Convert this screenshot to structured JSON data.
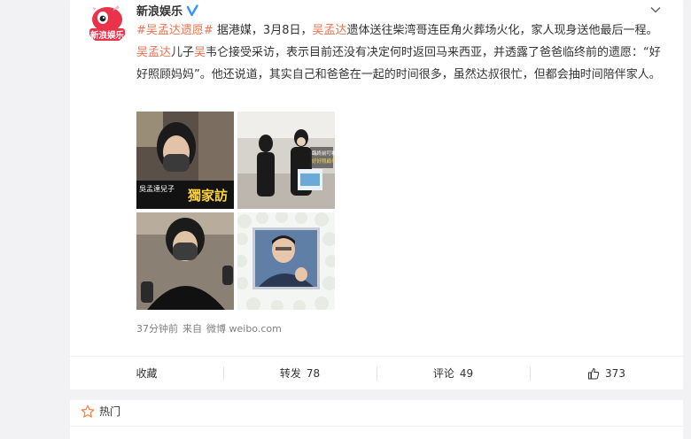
{
  "post": {
    "author": "新浪娱乐",
    "avatar_text": "新浪娱乐",
    "text": {
      "topic": "#吴孟达遗愿#",
      "seg1": " 据港媒，3月8日，",
      "mention1": "吴孟达",
      "seg2": "遗体送往柴湾哥连臣角火葬场火化，家人现身送他最后一程。",
      "mention2": "吴孟达",
      "seg3": "儿子",
      "mention3": "吴",
      "seg4": "韦仑接受采访，表示目前还没有决定何时返回马来西亚，并透露了爸爸临终前的遗愿：“好好照顾妈妈”。他还说道，其实自己和爸爸在一起的时间很多，虽然达叔很忙，但都会抽时间陪伴家人。"
    },
    "images": {
      "p1_caption_small": "吳孟達兒子",
      "p1_caption_big": "獨家訪",
      "p2_caption1": "臨終前叮囑",
      "p2_caption2": "好好照顧母親"
    },
    "meta": {
      "time": "37分钟前",
      "from_label": "来自",
      "source": "微博 weibo.com"
    },
    "actions": {
      "favorite": "收藏",
      "repost_label": "转发",
      "repost_count": "78",
      "comment_label": "评论",
      "comment_count": "49",
      "like_count": "373"
    }
  },
  "hot": {
    "title": "热门"
  },
  "colors": {
    "accent": "#eb7350",
    "verified": "#2f96ff",
    "hot_star": "#fa7d3c"
  }
}
